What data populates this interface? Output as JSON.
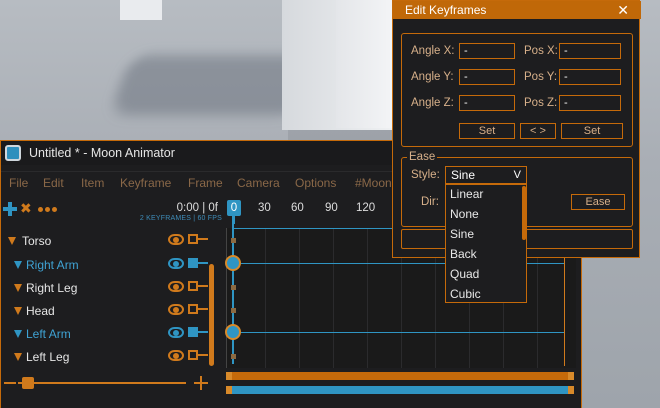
{
  "animator": {
    "title": "Untitled * - Moon Animator",
    "menu": [
      "File",
      "Edit",
      "Item",
      "Keyframe",
      "Frame",
      "Camera",
      "Options",
      "#Moona"
    ],
    "time": "0:00 | 0f",
    "keyframe_info": "2 KEYFRAMES | 60 FPS",
    "ruler": [
      "0",
      "30",
      "60",
      "90",
      "120"
    ],
    "tracks": [
      {
        "label": "Torso",
        "selected": false
      },
      {
        "label": "Right Arm",
        "selected": true
      },
      {
        "label": "Right Leg",
        "selected": false
      },
      {
        "label": "Head",
        "selected": false
      },
      {
        "label": "Left Arm",
        "selected": true
      },
      {
        "label": "Left Leg",
        "selected": false
      }
    ],
    "zoom_level": 0.05
  },
  "edit_keyframes": {
    "title": "Edit Keyframes",
    "close": "✕",
    "angle_x_label": "Angle X:",
    "angle_y_label": "Angle Y:",
    "angle_z_label": "Angle Z:",
    "pos_x_label": "Pos X:",
    "pos_y_label": "Pos Y:",
    "pos_z_label": "Pos Z:",
    "angle_x": "-",
    "angle_y": "-",
    "angle_z": "-",
    "pos_x": "-",
    "pos_y": "-",
    "pos_z": "-",
    "set_label": "Set",
    "nav_label": "<  >",
    "ease_title": "Ease",
    "style_label": "Style:",
    "style_value": "Sine",
    "style_chevron": "V",
    "dir_label": "Dir:",
    "ease_button": "Ease",
    "style_options": [
      "Linear",
      "None",
      "Sine",
      "Back",
      "Quad",
      "Cubic"
    ]
  },
  "colors": {
    "accent": "#c56a0a",
    "selection": "#2f95c3",
    "panel": "#1d1d1f"
  }
}
